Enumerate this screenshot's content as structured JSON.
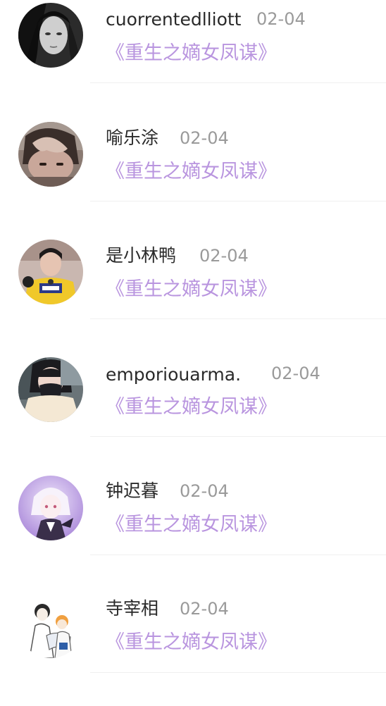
{
  "comments": [
    {
      "username": "cuorrentedlliott",
      "date": "02-04",
      "book": "《重生之嫡女凤谋》",
      "avatar_icon": "avatar-photo-girl-bw"
    },
    {
      "username": "喻乐涂",
      "date": "02-04",
      "book": "《重生之嫡女凤谋》",
      "avatar_icon": "avatar-photo-boy-hand"
    },
    {
      "username": "是小林鸭",
      "date": "02-04",
      "book": "《重生之嫡女凤谋》",
      "avatar_icon": "avatar-photo-boy-yellow-shirt"
    },
    {
      "username": "emporiouarma.",
      "date": "02-04",
      "book": "《重生之嫡女凤谋》",
      "avatar_icon": "avatar-photo-girl-mask"
    },
    {
      "username": "钟迟暮",
      "date": "02-04",
      "book": "《重生之嫡女凤谋》",
      "avatar_icon": "avatar-anime-purple"
    },
    {
      "username": "寺宰相",
      "date": "02-04",
      "book": "《重生之嫡女凤谋》",
      "avatar_icon": "avatar-anime-sketch"
    }
  ],
  "colors": {
    "username": "#2a2a2a",
    "date": "#9a9a9a",
    "book_link": "#b995df",
    "divider": "#f0f0f0"
  }
}
